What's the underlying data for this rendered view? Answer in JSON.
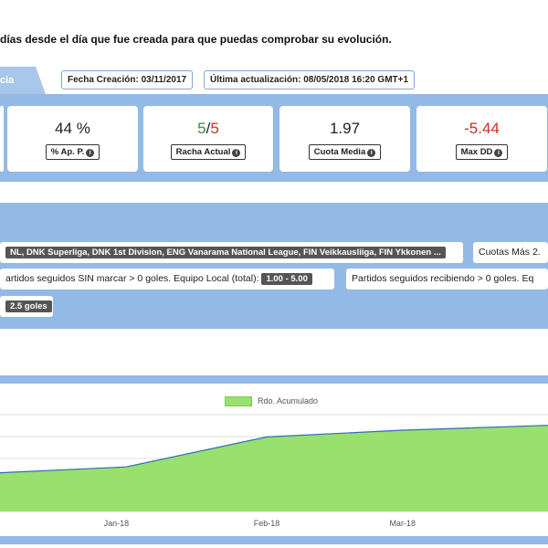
{
  "intro_text": "días desde el día que fue creada para que puedas comprobar su evolución.",
  "tab_label": "cia",
  "meta": {
    "created": "Fecha Creación: 03/11/2017",
    "updated": "Última actualización: 08/05/2018 16:20 GMT+1"
  },
  "stats": [
    {
      "value": "44 %",
      "label": "% Ap. P."
    },
    {
      "value_a": "5",
      "value_sep": "/",
      "value_b": "5",
      "label": "Racha Actual"
    },
    {
      "value": "1.97",
      "label": "Cuota Media"
    },
    {
      "value": "-5.44",
      "label": "Max DD"
    }
  ],
  "filters": {
    "leagues": "NL, DNK Superliga, DNK 1st Division, ENG Vanarama National League, FIN Veikkausliiga, FIN Ykkonen ...",
    "odds": "Cuotas Más 2.",
    "no_score_text": "artidos seguidos SIN marcar > 0 goles. Equipo Local (total):",
    "no_score_range": "1.00 - 5.00",
    "conceding_text": "Partidos seguidos recibiendo > 0 goles. Eq",
    "goals_tag": "2.5 goles"
  },
  "colors": {
    "band": "#93b9e6",
    "area_fill": "#99e06f",
    "line": "#2f6db5",
    "positive": "#3d8a3d",
    "negative": "#cc2b2b"
  },
  "chart_data": {
    "type": "area",
    "title": "",
    "legend": [
      "Rdo. Acumulado"
    ],
    "legend_position": "top-center",
    "grid": true,
    "x_ticks": [
      "Jan-18",
      "Feb-18",
      "Mar-18"
    ],
    "series": [
      {
        "name": "Rdo. Acumulado",
        "values": [
          {
            "x": "2017-12-08",
            "y": 1.0
          },
          {
            "x": "2018-01-03",
            "y": 1.6
          },
          {
            "x": "2018-02-01",
            "y": 4.7
          },
          {
            "x": "2018-03-01",
            "y": 5.4
          },
          {
            "x": "2018-03-31",
            "y": 5.9
          }
        ]
      }
    ],
    "ylim": [
      -3,
      7
    ]
  }
}
